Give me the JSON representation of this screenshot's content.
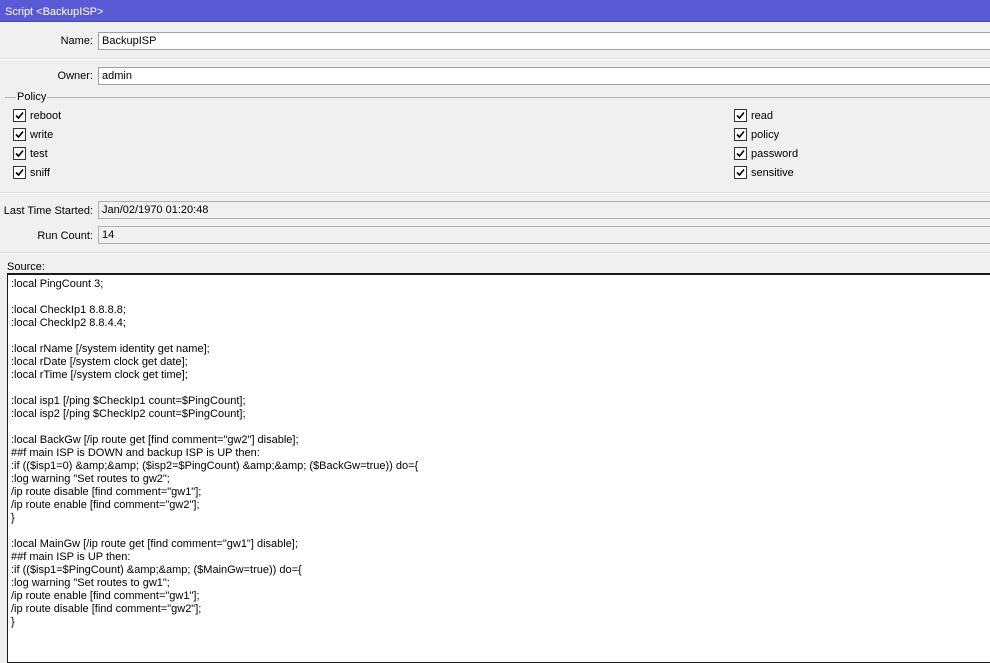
{
  "window": {
    "title": "Script <BackupISP>"
  },
  "fields": {
    "name": {
      "label": "Name:",
      "value": "BackupISP"
    },
    "owner": {
      "label": "Owner:",
      "value": "admin"
    },
    "last_time_started": {
      "label": "Last Time Started:",
      "value": "Jan/02/1970 01:20:48"
    },
    "run_count": {
      "label": "Run Count:",
      "value": "14"
    }
  },
  "policy": {
    "title": "Policy",
    "items": [
      {
        "label": "reboot",
        "checked": true
      },
      {
        "label": "write",
        "checked": true
      },
      {
        "label": "test",
        "checked": true
      },
      {
        "label": "sniff",
        "checked": true
      },
      {
        "label": "read",
        "checked": true
      },
      {
        "label": "policy",
        "checked": true
      },
      {
        "label": "password",
        "checked": true
      },
      {
        "label": "sensitive",
        "checked": true
      }
    ]
  },
  "source": {
    "label": "Source:",
    "lines": [
      ":local PingCount 3;",
      "",
      ":local CheckIp1 8.8.8.8;",
      ":local CheckIp2 8.8.4.4;",
      "",
      ":local rName [/system identity get name];",
      ":local rDate [/system clock get date];",
      ":local rTime [/system clock get time];",
      "",
      ":local isp1 [/ping $CheckIp1 count=$PingCount];",
      ":local isp2 [/ping $CheckIp2 count=$PingCount];",
      "",
      ":local BackGw [/ip route get [find comment=\"gw2\"] disable];",
      "##f main ISP is DOWN and backup ISP is UP then:",
      ":if (($isp1=0) &amp;&amp; ($isp2=$PingCount) &amp;&amp; ($BackGw=true)) do={",
      ":log warning \"Set routes to gw2\";",
      "/ip route disable [find comment=\"gw1\"];",
      "/ip route enable [find comment=\"gw2\"];",
      "}",
      "",
      ":local MainGw [/ip route get [find comment=\"gw1\"] disable];",
      "##f main ISP is UP then:",
      ":if (($isp1=$PingCount) &amp;&amp; ($MainGw=true)) do={",
      ":log warning \"Set routes to gw1\";",
      "/ip route enable [find comment=\"gw1\"];",
      "/ip route disable [find comment=\"gw2\"];",
      "}"
    ]
  }
}
